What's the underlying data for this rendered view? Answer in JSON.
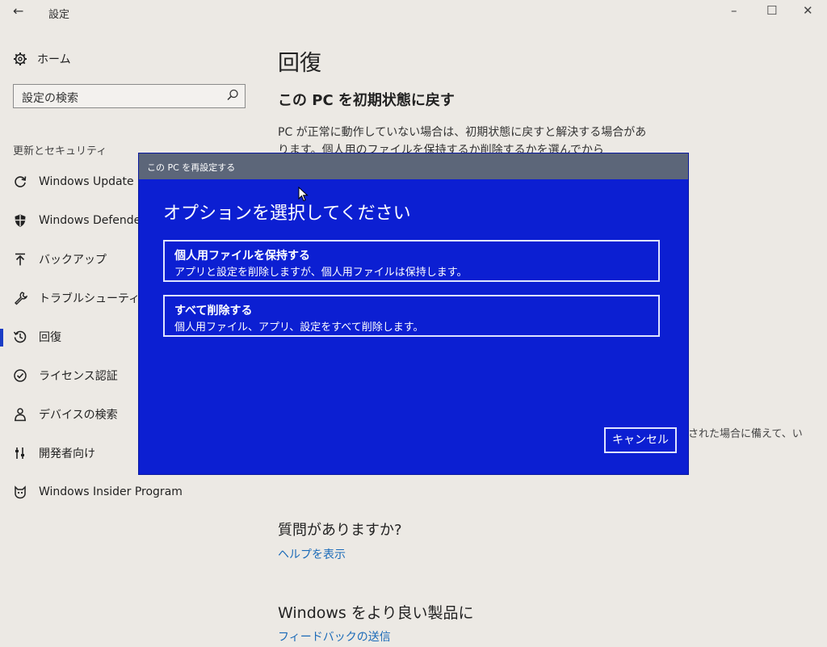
{
  "window": {
    "title": "設定",
    "controls": {
      "minimize": "–",
      "maximize": "☐",
      "close": "✕"
    }
  },
  "sidebar": {
    "home_label": "ホーム",
    "search": {
      "text": "設定の検索"
    },
    "section_label": "更新とセキュリティ",
    "items": [
      {
        "label": "Windows Update",
        "icon": "refresh-icon"
      },
      {
        "label": "Windows Defender",
        "icon": "shield-icon"
      },
      {
        "label": "バックアップ",
        "icon": "upload-arrow-icon"
      },
      {
        "label": "トラブルシューティング",
        "icon": "wrench-icon"
      },
      {
        "label": "回復",
        "icon": "history-icon",
        "active": true
      },
      {
        "label": "ライセンス認証",
        "icon": "check-circle-icon"
      },
      {
        "label": "デバイスの検索",
        "icon": "person-location-icon"
      },
      {
        "label": "開発者向け",
        "icon": "developer-tools-icon"
      },
      {
        "label": "Windows Insider Program",
        "icon": "insider-cat-icon"
      }
    ]
  },
  "main": {
    "title": "回復",
    "subtitle": "この PC を初期状態に戻す",
    "description": "PC が正常に動作していない場合は、初期状態に戻すと解決する場合があります。個人用のファイルを保持するか削除するかを選んでから Windows を再",
    "peek_text": "された場合に備えて、い",
    "faq_title": "質問がありますか?",
    "help_link": "ヘルプを表示",
    "better_title": "Windows をより良い製品に",
    "feedback_link": "フィードバックの送信"
  },
  "dialog": {
    "title": "この PC を再設定する",
    "heading": "オプションを選択してください",
    "options": [
      {
        "title": "個人用ファイルを保持する",
        "desc": "アプリと設定を削除しますが、個人用ファイルは保持します。"
      },
      {
        "title": "すべて削除する",
        "desc": "個人用ファイル、アプリ、設定をすべて削除します。"
      }
    ],
    "cancel_label": "キャンセル"
  },
  "colors": {
    "dialog_bg": "#0c1fd2",
    "dialog_titlebar": "#5c6679",
    "accent": "#1a3cc5",
    "link": "#1a6ab8",
    "background": "#ece9e4"
  }
}
